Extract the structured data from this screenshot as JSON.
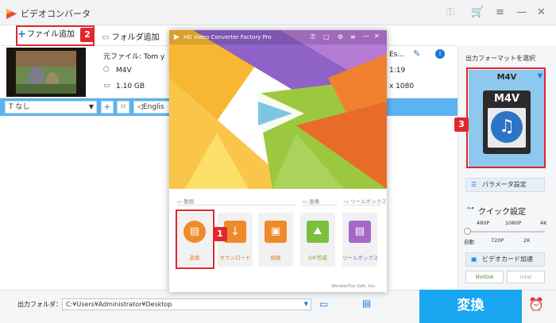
{
  "window": {
    "title": "ビデオコンバータ"
  },
  "toolbar": {
    "add_file": "ファイル追加",
    "add_folder": "フォルダ追加"
  },
  "file": {
    "source_label": "元ファイル: Tom y",
    "source_tail": "Es...",
    "format": "M4V",
    "size": "1.10 GB",
    "duration": "1:19",
    "resolution": "x 1080"
  },
  "controls": {
    "subtitle": "なし",
    "audio": "Englis"
  },
  "badges": {
    "b1": "1",
    "b2": "2",
    "b3": "3"
  },
  "popup": {
    "title": "HD Video Converter Factory Pro",
    "sec_video": "動画",
    "sec_image": "画像",
    "sec_toolbox": "ツールボックス",
    "tiles": [
      "変換",
      "ダウンロード",
      "録画",
      "GIF作成",
      "ツールボックス"
    ],
    "footer": "WonderFox Soft, Inc."
  },
  "right": {
    "header": "出力フォーマットを選択",
    "format": "M4V",
    "format_icon_text": "M4V",
    "param": "パラメータ設定",
    "quick": "クイック設定",
    "res": [
      "480P",
      "1080P",
      "4K"
    ],
    "res2": [
      "自動",
      "720P",
      "2K"
    ],
    "gpu": "ビデオカード加速",
    "nvidia": "NVIDIA",
    "intel": "intel"
  },
  "bottom": {
    "out_label": "出力フォルダ：",
    "path": "C:¥Users¥Administrator¥Desktop",
    "convert": "変換"
  },
  "colors": {
    "accent": "#19a6f0",
    "badge": "#e3262d",
    "tile": "#ef8a2a"
  }
}
